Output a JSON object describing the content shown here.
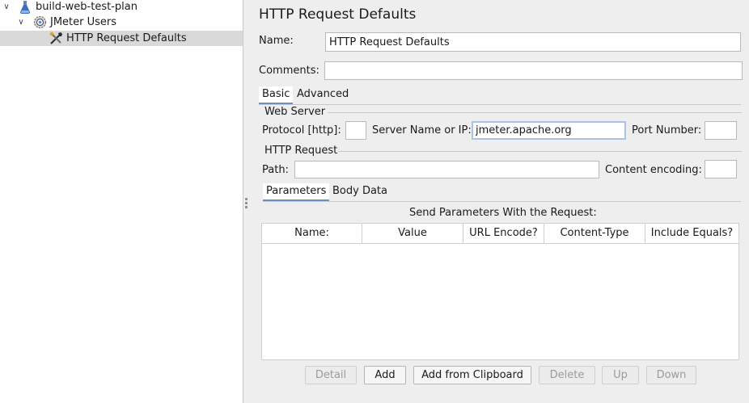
{
  "tree": {
    "items": [
      {
        "label": "build-web-test-plan",
        "toggle": "∨",
        "icon": "flask-icon"
      },
      {
        "label": "JMeter Users",
        "toggle": "∨",
        "icon": "gear-icon"
      },
      {
        "label": "HTTP Request Defaults",
        "toggle": "",
        "icon": "tools-icon"
      }
    ]
  },
  "panel": {
    "title": "HTTP Request Defaults",
    "name_label": "Name:",
    "name_value": "HTTP Request Defaults",
    "comments_label": "Comments:",
    "comments_value": "",
    "tabs": [
      {
        "label": "Basic"
      },
      {
        "label": "Advanced"
      }
    ],
    "web_server": {
      "title": "Web Server",
      "protocol_label": "Protocol [http]:",
      "protocol_value": "",
      "server_label": "Server Name or IP:",
      "server_value": "jmeter.apache.org",
      "port_label": "Port Number:",
      "port_value": ""
    },
    "http_request": {
      "title": "HTTP Request",
      "path_label": "Path:",
      "path_value": "",
      "encoding_label": "Content encoding:",
      "encoding_value": ""
    },
    "subtabs": [
      {
        "label": "Parameters"
      },
      {
        "label": "Body Data"
      }
    ],
    "params": {
      "caption": "Send Parameters With the Request:",
      "columns": [
        "Name:",
        "Value",
        "URL Encode?",
        "Content-Type",
        "Include Equals?"
      ],
      "rows": []
    },
    "buttons": {
      "detail": "Detail",
      "add": "Add",
      "add_clipboard": "Add from Clipboard",
      "delete": "Delete",
      "up": "Up",
      "down": "Down"
    }
  }
}
